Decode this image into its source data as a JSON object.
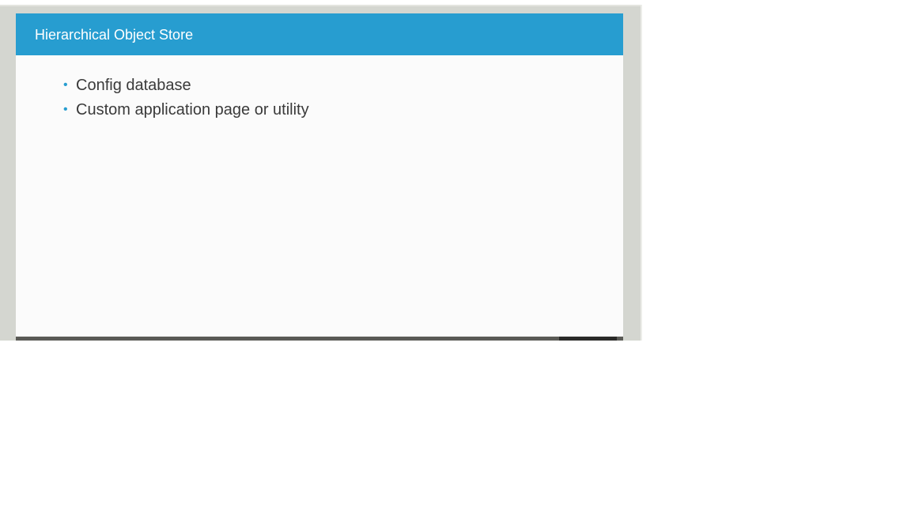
{
  "slide": {
    "title": "Hierarchical Object Store",
    "bullets": [
      "Config database",
      "Custom application page or utility"
    ],
    "bullet_glyph": "•"
  },
  "colors": {
    "accent": "#279dd0",
    "slide_background": "#fbfbfb",
    "frame_background": "#d4d6d0",
    "text": "#3a3a3a"
  }
}
